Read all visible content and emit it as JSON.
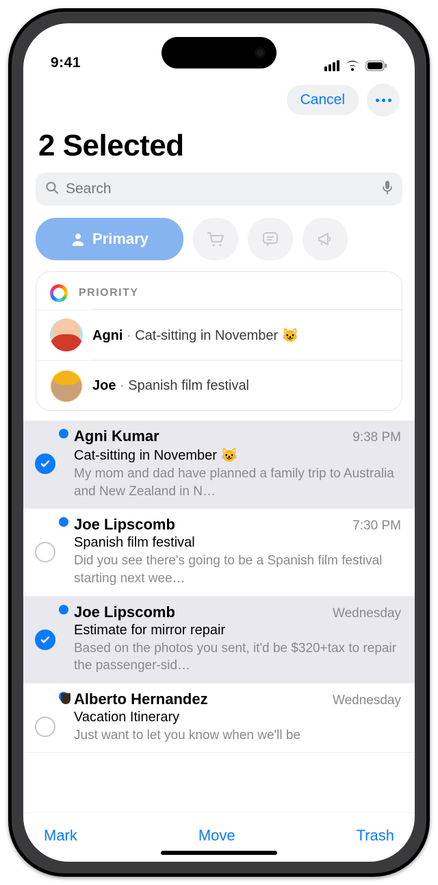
{
  "status": {
    "time": "9:41"
  },
  "header": {
    "cancel": "Cancel",
    "title": "2 Selected"
  },
  "search": {
    "placeholder": "Search"
  },
  "categories": {
    "primary_label": "Primary"
  },
  "priority": {
    "label": "PRIORITY",
    "items": [
      {
        "name": "Agni",
        "subject": "Cat-sitting in November 😺"
      },
      {
        "name": "Joe",
        "subject": "Spanish film festival"
      }
    ]
  },
  "messages": [
    {
      "from": "Agni Kumar",
      "time": "9:38 PM",
      "subject": "Cat-sitting in November 😺",
      "preview": "My mom and dad have planned a family trip to Australia and New Zealand in N…",
      "selected": true,
      "unread": true,
      "avatar": "agni"
    },
    {
      "from": "Joe Lipscomb",
      "time": "7:30 PM",
      "subject": "Spanish film festival",
      "preview": "Did you see there's going to be a Spanish film festival starting next wee…",
      "selected": false,
      "unread": true,
      "avatar": "joe"
    },
    {
      "from": "Joe Lipscomb",
      "time": "Wednesday",
      "subject": "Estimate for mirror repair",
      "preview": "Based on the photos you sent, it'd be $320+tax to repair the passenger-sid…",
      "selected": true,
      "unread": true,
      "avatar": "joe"
    },
    {
      "from": "Alberto Hernandez",
      "time": "Wednesday",
      "subject": "Vacation Itinerary",
      "preview": "Just want to let you know when we'll be",
      "selected": false,
      "unread": true,
      "avatar": "alb"
    }
  ],
  "toolbar": {
    "mark": "Mark",
    "move": "Move",
    "trash": "Trash"
  }
}
